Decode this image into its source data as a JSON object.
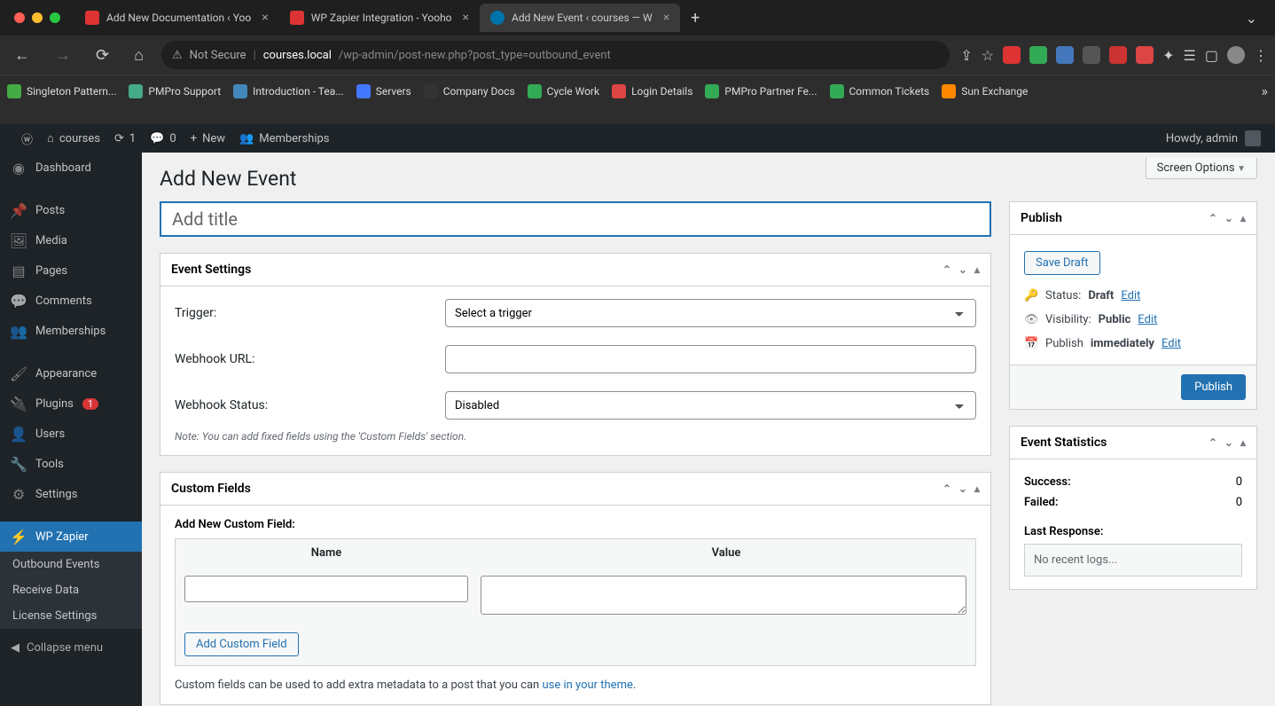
{
  "browser": {
    "tabs": [
      {
        "title": "Add New Documentation ‹ Yoo"
      },
      {
        "title": "WP Zapier Integration - Yooho"
      },
      {
        "title": "Add New Event ‹ courses — W",
        "active": true
      }
    ],
    "url": {
      "not_secure": "Not Secure",
      "host": "courses.local",
      "path": "/wp-admin/post-new.php?post_type=outbound_event"
    },
    "bookmarks": [
      "Singleton Pattern...",
      "PMPro Support",
      "Introduction - Tea...",
      "Servers",
      "Company Docs",
      "Cycle Work",
      "Login Details",
      "PMPro Partner Fe...",
      "Common Tickets",
      "Sun Exchange"
    ]
  },
  "wp_admin_bar": {
    "site_name": "courses",
    "updates": "1",
    "comments": "0",
    "new": "New",
    "memberships": "Memberships",
    "howdy": "Howdy, admin"
  },
  "sidebar": {
    "items": [
      {
        "label": "Dashboard",
        "icon": "dash"
      },
      {
        "label": "Posts",
        "icon": "pin"
      },
      {
        "label": "Media",
        "icon": "media"
      },
      {
        "label": "Pages",
        "icon": "page"
      },
      {
        "label": "Comments",
        "icon": "comment"
      },
      {
        "label": "Memberships",
        "icon": "memb"
      },
      {
        "label": "Appearance",
        "icon": "brush"
      },
      {
        "label": "Plugins",
        "icon": "plug",
        "badge": "1"
      },
      {
        "label": "Users",
        "icon": "user"
      },
      {
        "label": "Tools",
        "icon": "tool"
      },
      {
        "label": "Settings",
        "icon": "gear"
      },
      {
        "label": "WP Zapier",
        "icon": "zap",
        "active": true
      }
    ],
    "submenu": [
      "Outbound Events",
      "Receive Data",
      "License Settings"
    ],
    "collapse": "Collapse menu"
  },
  "page": {
    "screen_options": "Screen Options",
    "title": "Add New Event",
    "title_placeholder": "Add title",
    "event_settings": {
      "heading": "Event Settings",
      "trigger_label": "Trigger:",
      "trigger_value": "Select a trigger",
      "webhook_url_label": "Webhook URL:",
      "webhook_url_value": "",
      "webhook_status_label": "Webhook Status:",
      "webhook_status_value": "Disabled",
      "note": "Note: You can add fixed fields using the 'Custom Fields' section."
    },
    "custom_fields": {
      "heading": "Custom Fields",
      "add_heading": "Add New Custom Field:",
      "name_col": "Name",
      "value_col": "Value",
      "add_button": "Add Custom Field",
      "help_text": "Custom fields can be used to add extra metadata to a post that you can ",
      "help_link": "use in your theme"
    },
    "publish": {
      "heading": "Publish",
      "save_draft": "Save Draft",
      "status_label": "Status:",
      "status_value": "Draft",
      "visibility_label": "Visibility:",
      "visibility_value": "Public",
      "publish_label_prefix": "Publish",
      "publish_value": "immediately",
      "edit": "Edit",
      "publish_button": "Publish"
    },
    "stats": {
      "heading": "Event Statistics",
      "success_label": "Success:",
      "success_val": "0",
      "failed_label": "Failed:",
      "failed_val": "0",
      "last_response": "Last Response:",
      "log": "No recent logs..."
    }
  }
}
